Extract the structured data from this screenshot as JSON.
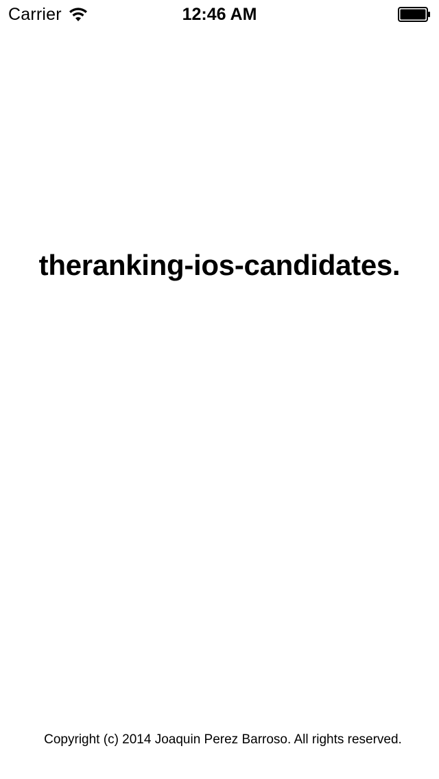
{
  "status_bar": {
    "carrier": "Carrier",
    "time": "12:46 AM",
    "wifi_icon": "wifi-icon",
    "battery_icon": "battery-icon",
    "battery_level": 1.0
  },
  "main": {
    "headline": "theranking-ios-candidates."
  },
  "footer": {
    "copyright": "Copyright (c) 2014 Joaquin Perez Barroso. All rights reserved."
  },
  "colors": {
    "background": "#ffffff",
    "text": "#000000"
  }
}
